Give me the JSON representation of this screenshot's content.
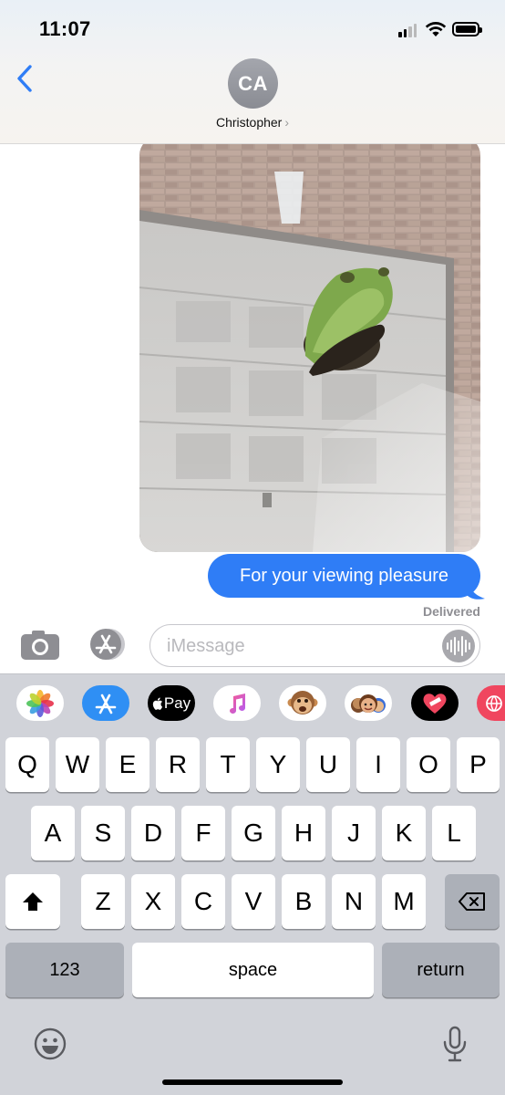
{
  "status_bar": {
    "time": "11:07"
  },
  "header": {
    "avatar_initials": "CA",
    "contact_name": "Christopher",
    "contact_chevron": "›"
  },
  "thread": {
    "message_text": "For your viewing pleasure",
    "delivery_status": "Delivered",
    "bubble_color": "#2f7df6"
  },
  "composer": {
    "placeholder": "iMessage"
  },
  "app_strip": {
    "apple_pay_label": "Pay",
    "icons": [
      "photos-icon",
      "app-store-icon",
      "apple-pay-icon",
      "music-icon",
      "monkey-memoji-icon",
      "memoji-icon",
      "heart-sticker-icon",
      "globe-icon"
    ]
  },
  "keyboard": {
    "row1": [
      "Q",
      "W",
      "E",
      "R",
      "T",
      "Y",
      "U",
      "I",
      "O",
      "P"
    ],
    "row2": [
      "A",
      "S",
      "D",
      "F",
      "G",
      "H",
      "J",
      "K",
      "L"
    ],
    "row3": [
      "Z",
      "X",
      "C",
      "V",
      "B",
      "N",
      "M"
    ],
    "numbers_label": "123",
    "space_label": "space",
    "return_label": "return"
  }
}
